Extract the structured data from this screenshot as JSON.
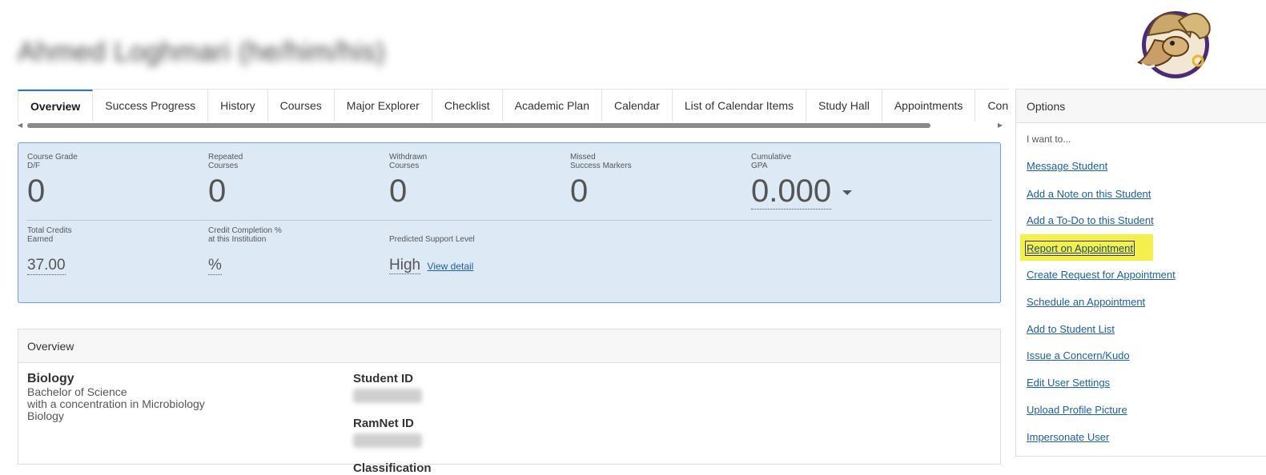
{
  "student": {
    "name": "Ahmed Loghmari (he/him/his)"
  },
  "tabs": [
    "Overview",
    "Success Progress",
    "History",
    "Courses",
    "Major Explorer",
    "Checklist",
    "Academic Plan",
    "Calendar",
    "List of Calendar Items",
    "Study Hall",
    "Appointments",
    "Con"
  ],
  "active_tab": "Overview",
  "stats": {
    "course_grade_label_1": "Course Grade",
    "course_grade_label_2": "D/F",
    "course_grade_value": "0",
    "repeated_label_1": "Repeated",
    "repeated_label_2": "Courses",
    "repeated_value": "0",
    "withdrawn_label_1": "Withdrawn",
    "withdrawn_label_2": "Courses",
    "withdrawn_value": "0",
    "missed_label_1": "Missed",
    "missed_label_2": "Success Markers",
    "missed_value": "0",
    "gpa_label_1": "Cumulative",
    "gpa_label_2": "GPA",
    "gpa_value": "0.000",
    "credits_label_1": "Total Credits",
    "credits_label_2": "Earned",
    "credits_value": "37.00",
    "completion_label_1": "Credit Completion %",
    "completion_label_2": "at this Institution",
    "completion_value": "%",
    "support_label": "Predicted Support Level",
    "support_value": "High",
    "view_detail": "View detail"
  },
  "overview": {
    "header": "Overview",
    "major_title": "Biology",
    "major_lines": [
      "Bachelor of Science",
      "with a concentration in Microbiology",
      "Biology"
    ],
    "student_id_label": "Student ID",
    "ramnet_id_label": "RamNet ID",
    "classification_label": "Classification"
  },
  "options": {
    "header": "Options",
    "intro": "I want to...",
    "links": [
      "Message Student",
      "Add a Note on this Student",
      "Add a To-Do to this Student",
      "Report on Appointment",
      "Create Request for Appointment",
      "Schedule an Appointment",
      "Add to Student List",
      "Issue a Concern/Kudo",
      "Edit User Settings",
      "Upload Profile Picture",
      "Impersonate User"
    ],
    "highlighted": "Report on Appointment"
  },
  "colors": {
    "accent": "#2a7ab8",
    "link": "#1a5fa8",
    "highlight": "#f5ef4a",
    "stats_bg": "#ddeaf6"
  }
}
